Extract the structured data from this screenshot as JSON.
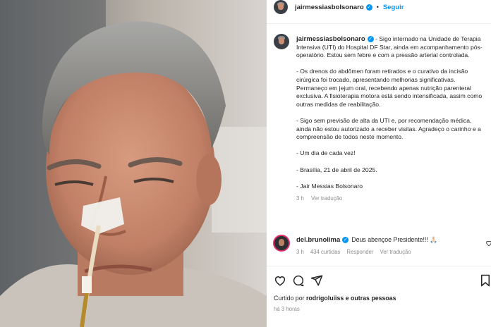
{
  "post": {
    "username": "jairmessiasbolsonaro",
    "follow_label": "Seguir",
    "more_label": "...",
    "caption_paragraphs": [
      "- Sigo internado na Unidade de Terapia Intensiva (UTI) do Hospital DF Star, ainda em acompanhamento pós-operatório. Estou sem febre e com a pressão arterial controlada.",
      "- Os drenos do abdômen foram retirados e o curativo da incisão cirúrgica foi trocado, apresentando melhorias significativas. Permaneço em jejum oral, recebendo apenas nutrição parenteral exclusiva. A fisioterapia motora está sendo intensificada, assim como outras medidas de reabilitação.",
      "- Sigo sem previsão de alta da UTI e, por recomendação médica, ainda não estou autorizado a receber visitas. Agradeço o carinho e a compreensão de todos neste momento.",
      "- Um dia de cada vez!",
      "- Brasília, 21 de abril de 2025.",
      "- Jair Messias Bolsonaro"
    ],
    "caption_time": "3 h",
    "caption_translate": "Ver tradução"
  },
  "comment": {
    "username": "del.brunolima",
    "text": "Deus abençoe Presidente!!! 🙏🏻",
    "time": "3 h",
    "likes": "434 curtidas",
    "reply": "Responder",
    "translate": "Ver tradução"
  },
  "footer": {
    "liked_prefix": "Curtido por ",
    "liked_user": "rodrigoluiiss",
    "liked_suffix": " e outras pessoas",
    "time_ago": "há 3 horas"
  },
  "colors": {
    "accent": "#0095f6",
    "text": "#262626",
    "muted": "#8e8e8e"
  },
  "icons": [
    "heart-icon",
    "comment-icon",
    "share-icon",
    "bookmark-icon",
    "verified-icon",
    "like-comment-icon"
  ]
}
